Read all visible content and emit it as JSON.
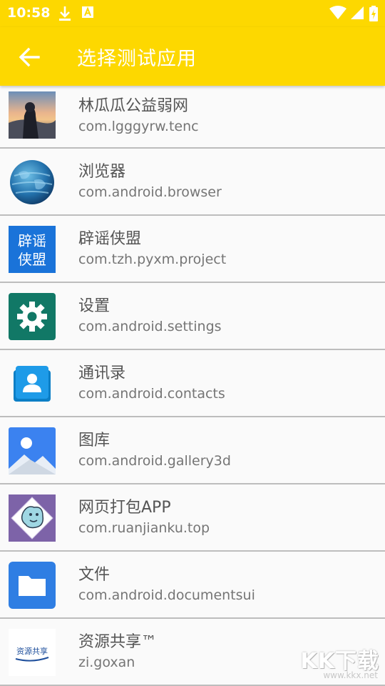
{
  "status": {
    "time": "10:58"
  },
  "header": {
    "title": "选择测试应用"
  },
  "apps": [
    {
      "name": "林瓜瓜公益弱网",
      "package": "com.lgggyrw.tenc",
      "icon": "photo-avatar-icon"
    },
    {
      "name": "浏览器",
      "package": "com.android.browser",
      "icon": "globe-icon"
    },
    {
      "name": "辟谣侠盟",
      "package": "com.tzh.pyxm.project",
      "icon": "piyaoxiameng-logo-icon",
      "icon_text": [
        "辟谣",
        "侠盟"
      ]
    },
    {
      "name": "设置",
      "package": "com.android.settings",
      "icon": "gear-icon"
    },
    {
      "name": "通讯录",
      "package": "com.android.contacts",
      "icon": "contacts-icon"
    },
    {
      "name": "图库",
      "package": "com.android.gallery3d",
      "icon": "gallery-icon"
    },
    {
      "name": "网页打包APP",
      "package": "com.ruanjianku.top",
      "icon": "cartoon-dog-icon"
    },
    {
      "name": "文件",
      "package": "com.android.documentsui",
      "icon": "folder-icon"
    },
    {
      "name": "资源共享™",
      "package": "zi.goxan",
      "icon": "ziyuan-logo-icon",
      "icon_text": "资源共享"
    }
  ],
  "watermark": {
    "main": "KK下载",
    "url": "www.kkx.net"
  },
  "colors": {
    "accent": "#fdd800",
    "divider": "#bdbdbd",
    "text_primary": "#555555",
    "text_secondary": "#757575"
  }
}
